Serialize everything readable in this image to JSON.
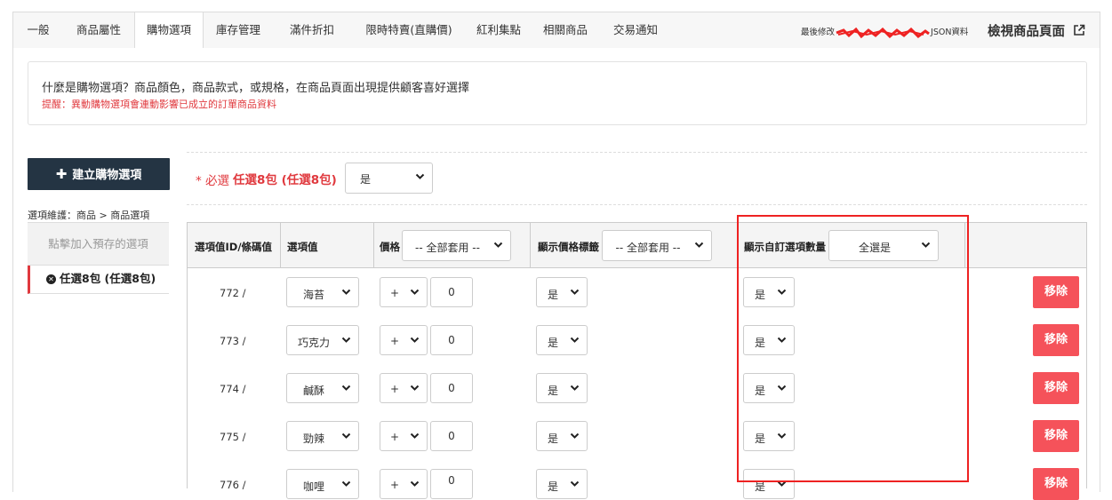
{
  "tabs": [
    "一般",
    "商品屬性",
    "購物選項",
    "庫存管理",
    "滿件折扣",
    "限時特賣(直購價)",
    "紅利集點",
    "相關商品",
    "交易通知"
  ],
  "active_tab": "購物選項",
  "header": {
    "last_modified_label": "最後修改",
    "json_label": "JSON資料",
    "view_page_label": "檢視商品頁面",
    "external_icon": "external-link-icon"
  },
  "info": {
    "title": "什麼是購物選項？商品顏色，商品款式，或規格，在商品頁面出現提供顧客喜好選擇",
    "warning": "提醒：異動購物選項會連動影響已成立的訂單商品資料"
  },
  "create_button_label": "建立購物選項",
  "sidebar": {
    "maintenance_label": "選項維護：商品 > 商品選項",
    "preset_label": "點擊加入預存的選項",
    "selected_item": "任選8包 (任選8包)"
  },
  "option_header": {
    "required_label": "* 必選",
    "option_name": "任選8包 (任選8包)",
    "required_value": "是"
  },
  "table": {
    "headers": {
      "id": "選項值ID/條碼值",
      "value": "選項值",
      "price": "價格",
      "price_apply_all": "-- 全部套用 --",
      "show_price_tag": "顯示價格標籤",
      "show_price_tag_apply_all": "-- 全部套用 --",
      "show_custom_qty": "顯示自訂選項數量",
      "show_custom_qty_all": "全選是"
    },
    "rows": [
      {
        "id": "772 /",
        "value": "海苔",
        "sign": "+",
        "price": "0",
        "show_price_tag": "是",
        "show_custom_qty": "是",
        "remove": "移除"
      },
      {
        "id": "773 /",
        "value": "巧克力",
        "sign": "+",
        "price": "0",
        "show_price_tag": "是",
        "show_custom_qty": "是",
        "remove": "移除"
      },
      {
        "id": "774 /",
        "value": "鹹酥",
        "sign": "+",
        "price": "0",
        "show_price_tag": "是",
        "show_custom_qty": "是",
        "remove": "移除"
      },
      {
        "id": "775 /",
        "value": "勁辣",
        "sign": "+",
        "price": "0",
        "show_price_tag": "是",
        "show_custom_qty": "是",
        "remove": "移除"
      },
      {
        "id": "776 /",
        "value": "咖哩",
        "sign": "+",
        "price": "0",
        "show_price_tag": "是",
        "show_custom_qty": "是",
        "remove": "移除"
      }
    ]
  },
  "colors": {
    "accent_red": "#e0393e",
    "remove_button": "#f5525a",
    "dark_button": "#243443",
    "highlight_box": "#ee2222"
  }
}
